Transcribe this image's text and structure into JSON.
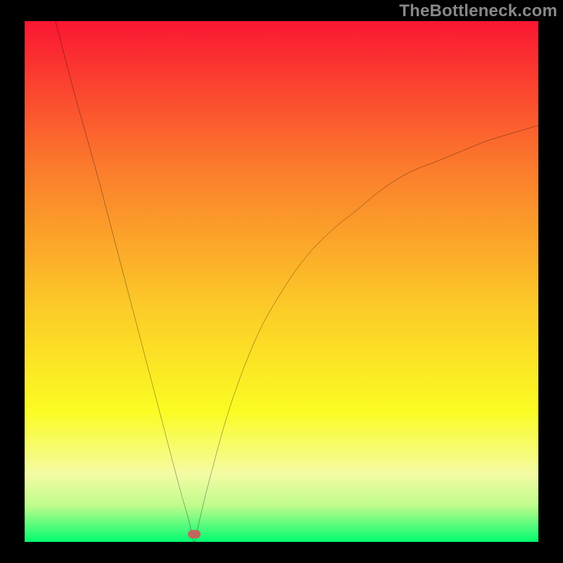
{
  "watermark": "TheBottleneck.com",
  "colors": {
    "top": "#fb1632",
    "upper_mid": "#fb7b2c",
    "mid": "#fccb28",
    "lower_mid": "#fbfc23",
    "pale": "#f4fba4",
    "near_bottom": "#bffc8c",
    "bottom": "#02fb6f",
    "marker": "#c0675d",
    "curve": "#000000"
  },
  "chart_data": {
    "type": "line",
    "title": "",
    "xlabel": "",
    "ylabel": "",
    "xlim": [
      0,
      100
    ],
    "ylim": [
      0,
      100
    ],
    "minimum_x": 33,
    "curve_description": "V-shaped bottleneck curve with sharp minimum near x=33; left branch nearly linear from (6,100) to (33,0); right branch rises with decreasing slope toward (100,80)",
    "series": [
      {
        "name": "bottleneck-curve",
        "x": [
          6,
          10,
          14,
          18,
          22,
          26,
          30,
          32,
          33,
          34,
          36,
          40,
          45,
          50,
          55,
          60,
          65,
          70,
          75,
          80,
          85,
          90,
          95,
          100
        ],
        "values": [
          100,
          85,
          71,
          56,
          41,
          26,
          11,
          4,
          0,
          4,
          12,
          26,
          39,
          48,
          55,
          60,
          64,
          68,
          71,
          73,
          75,
          77,
          78.5,
          80
        ]
      }
    ],
    "marker": {
      "x": 33,
      "y": 1.5
    }
  }
}
